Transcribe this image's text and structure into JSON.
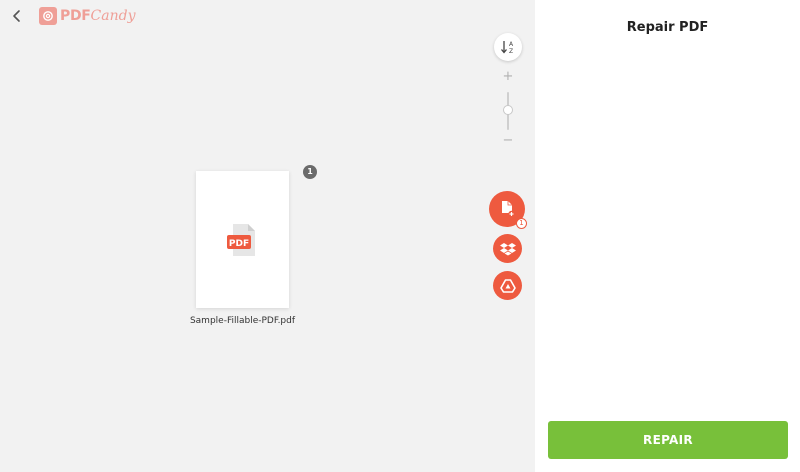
{
  "header": {
    "back_icon": "chevron-left-icon",
    "logo_pdf": "PDF",
    "logo_candy": "Candy"
  },
  "toolbar": {
    "sort_icon": "sort-az-icon",
    "zoom_plus": "+",
    "zoom_minus": "−",
    "add_file_icon": "add-file-icon",
    "add_file_badge": "1",
    "dropbox_icon": "dropbox-icon",
    "gdrive_icon": "google-drive-icon"
  },
  "files": [
    {
      "name": "Sample-Fillable-PDF.pdf",
      "icon_label": "PDF",
      "count": "1"
    }
  ],
  "panel": {
    "title": "Repair PDF",
    "action_label": "REPAIR"
  },
  "colors": {
    "accent": "#ee5a3f",
    "action": "#78c03a",
    "logo": "#ef9f97"
  }
}
